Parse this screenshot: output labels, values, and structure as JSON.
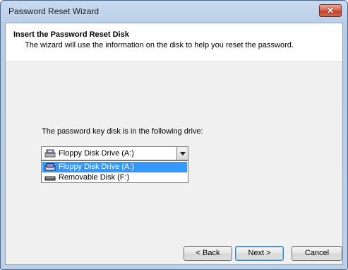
{
  "window": {
    "title": "Password Reset Wizard",
    "close_label": "✕"
  },
  "header": {
    "title": "Insert the Password Reset Disk",
    "subtitle": "The wizard will use the information on the disk to help you reset the password."
  },
  "drive": {
    "label": "The password key disk is in the following drive:",
    "selected": "Floppy Disk Drive (A:)",
    "options": [
      {
        "label": "Floppy Disk Drive (A:)",
        "icon": "floppy-drive-icon",
        "selected": true
      },
      {
        "label": "Removable Disk (F:)",
        "icon": "removable-disk-icon",
        "selected": false
      }
    ]
  },
  "buttons": {
    "back": "< Back",
    "next": "Next >",
    "cancel": "Cancel"
  },
  "colors": {
    "selection": "#3399ff",
    "close": "#c2412a"
  }
}
